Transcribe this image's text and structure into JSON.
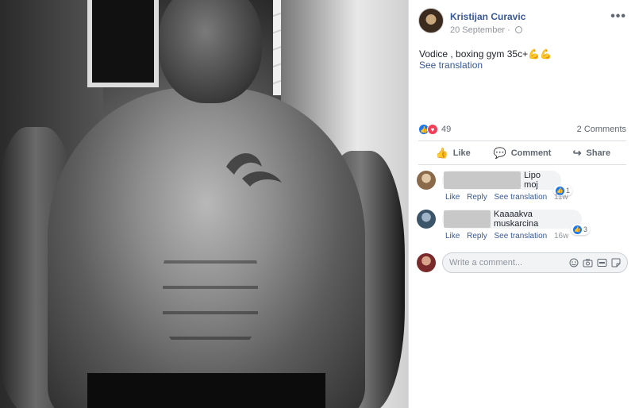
{
  "post": {
    "author": "Kristijan Curavic",
    "date": "20 September",
    "date_separator": "·",
    "more": "•••",
    "text": "Vodice , boxing gym 35c+",
    "text_emoji": "💪💪",
    "see_translation": "See translation"
  },
  "reactions": {
    "count": "49",
    "comments_label": "2 Comments",
    "like_glyph": "👍",
    "love_glyph": "♥"
  },
  "actions": {
    "like": "Like",
    "comment": "Comment",
    "share": "Share",
    "like_icon": "👍",
    "comment_icon": "💬",
    "share_icon": "↪"
  },
  "comments": [
    {
      "text": "Lipo moj",
      "like": "Like",
      "reply": "Reply",
      "see_translation": "See translation",
      "time": "11w",
      "reaction_count": "1"
    },
    {
      "text": "Kaaaakva muskarcina",
      "like": "Like",
      "reply": "Reply",
      "see_translation": "See translation",
      "time": "16w",
      "reaction_count": "3"
    }
  ],
  "composer": {
    "placeholder": "Write a comment...",
    "icons": [
      "emoji-icon",
      "camera-icon",
      "gif-icon",
      "sticker-icon"
    ]
  },
  "colors": {
    "link": "#385898",
    "muted": "#90949c",
    "like_blue": "#1877f2",
    "love_red": "#f33e58"
  }
}
